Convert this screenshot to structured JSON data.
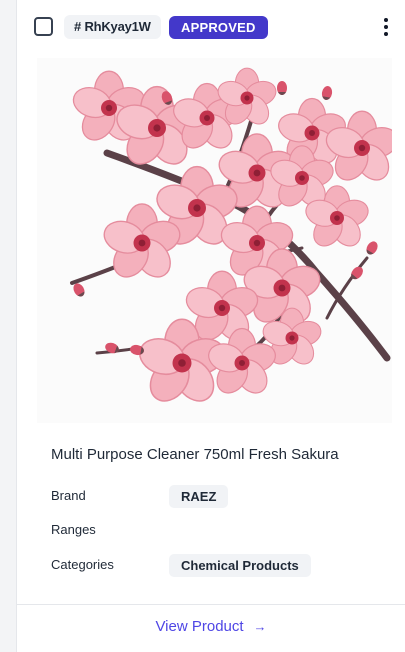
{
  "card": {
    "code": "# RhKyay1W",
    "status": "APPROVED",
    "title": "Multi Purpose Cleaner 750ml Fresh Sakura",
    "attributes": [
      {
        "label": "Brand",
        "value": "RAEZ"
      },
      {
        "label": "Ranges",
        "value": ""
      },
      {
        "label": "Categories",
        "value": "Chemical Products"
      }
    ],
    "view_label": "View Product",
    "view_arrow": "→"
  },
  "icons": {
    "menu": "more-vertical-icon",
    "arrow": "arrow-right-icon",
    "image": "cherry-blossom-branch-image"
  },
  "colors": {
    "accent": "#4f46e5",
    "badge": "#4338ca",
    "petal": "#f3a7b4",
    "petal_dark": "#e07a8c",
    "branch": "#5b4148"
  }
}
